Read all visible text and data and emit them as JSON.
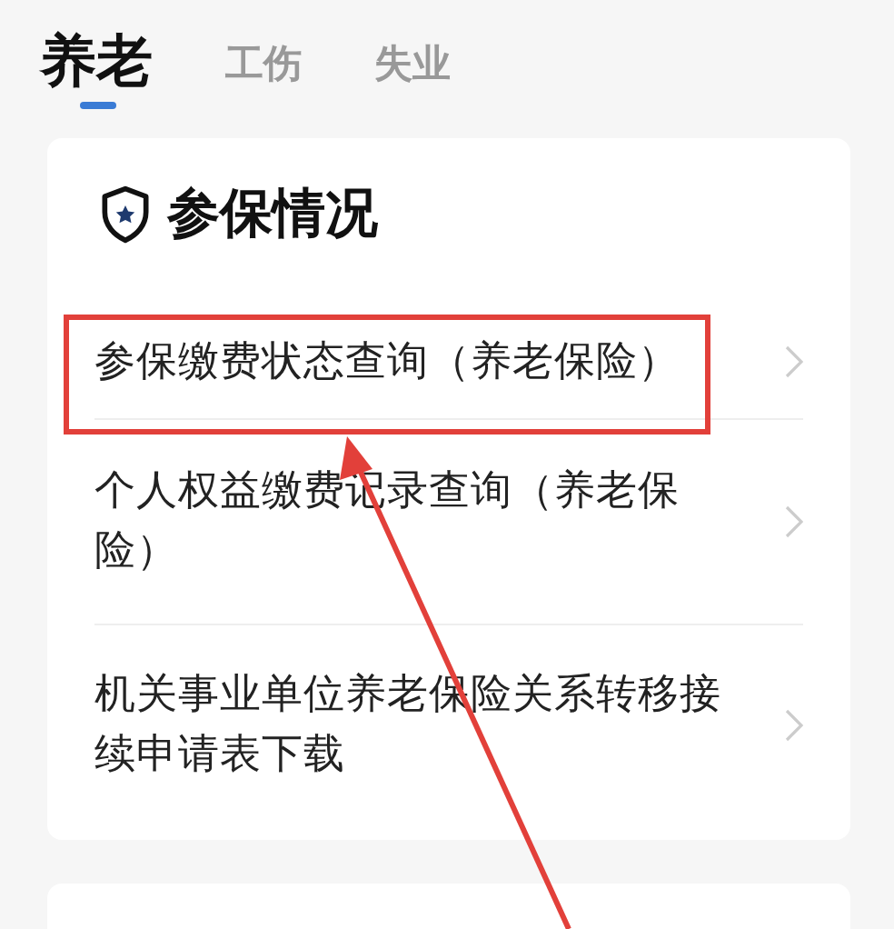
{
  "tabs": [
    {
      "label": "养老",
      "selected": true
    },
    {
      "label": "工伤",
      "selected": false
    },
    {
      "label": "失业",
      "selected": false
    }
  ],
  "section": {
    "title": "参保情况",
    "items": [
      {
        "label": "参保缴费状态查询（养老保险）",
        "highlighted": true
      },
      {
        "label": "个人权益缴费记录查询（养老保险）",
        "highlighted": false
      },
      {
        "label": "机关事业单位养老保险关系转移接续申请表下载",
        "highlighted": false
      }
    ]
  }
}
